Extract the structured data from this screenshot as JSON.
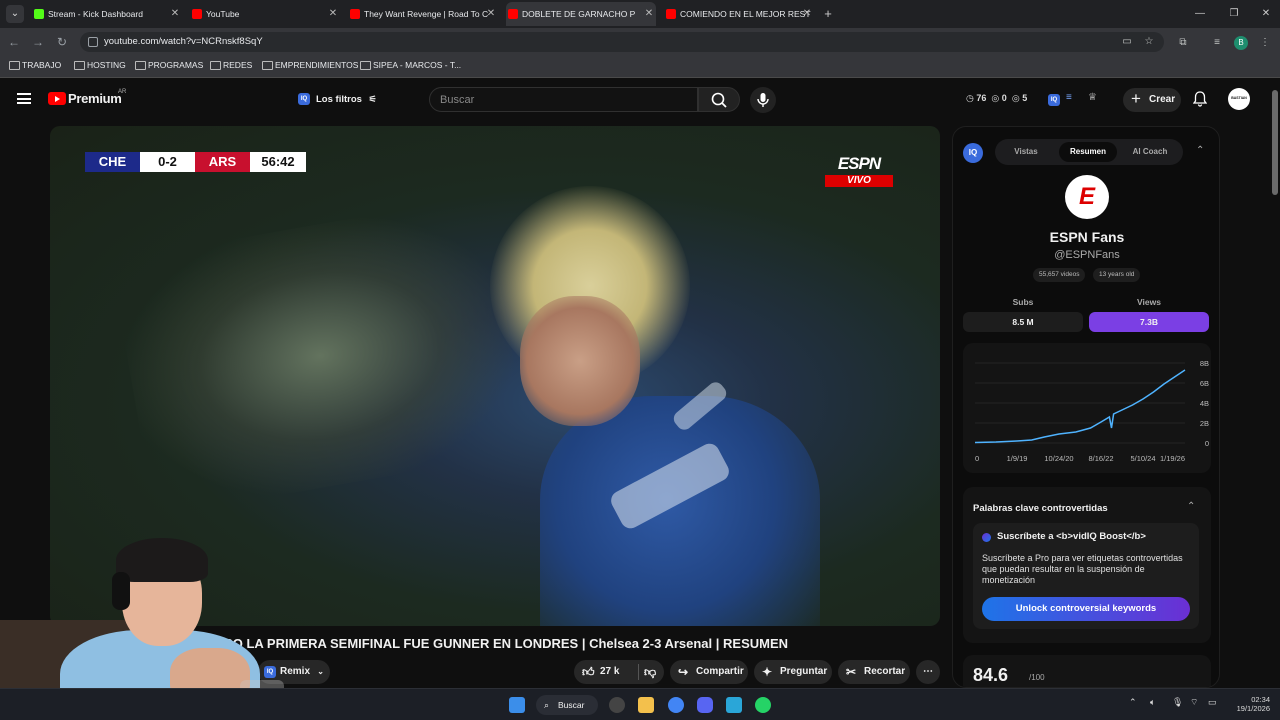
{
  "browser": {
    "tabs": [
      {
        "title": "Stream - Kick Dashboard",
        "color": "#53fc18"
      },
      {
        "title": "YouTube",
        "color": "#ff0000"
      },
      {
        "title": "They Want Revenge | Road To C",
        "color": "#ff0000"
      },
      {
        "title": "DOBLETE DE GARNACHO P",
        "color": "#ff0000"
      },
      {
        "title": "COMIENDO EN EL MEJOR REST",
        "color": "#ff0000"
      }
    ],
    "new_tab": "+",
    "url": "youtube.com/watch?v=NCRnskf8SqY",
    "profile_initial": "B",
    "bookmarks": [
      "TRABAJO",
      "HOSTING",
      "PROGRAMAS",
      "REDES",
      "EMPRENDIMIENTOS",
      "SIPEA - MARCOS - T..."
    ]
  },
  "youtube": {
    "logo_text": "Premium",
    "region": "AR",
    "filters_label": "Los filtros",
    "search_placeholder": "Buscar",
    "stats": {
      "clock": "76",
      "eye": "0",
      "check": "5"
    },
    "create_label": "Crear",
    "avatar_text": "BASTIAN"
  },
  "video": {
    "scoreboard": {
      "home": "CHE",
      "score": "0-2",
      "away": "ARS",
      "time": "56:42"
    },
    "broadcaster": "ESPN",
    "live_badge": "VIVO",
    "title": "PERO LA PRIMERA SEMIFINAL FUE GUNNER EN LONDRES | Chelsea 2-3 Arsenal | RESUMEN",
    "subscribe_partial": "irse",
    "remix_label": "Remix",
    "likes": "27 k",
    "share_label": "Compartir",
    "ask_label": "Preguntar",
    "clip_label": "Recortar"
  },
  "vidiq": {
    "tabs": [
      "Vistas",
      "Resumen",
      "AI Coach"
    ],
    "active_tab": "Resumen",
    "channel_name": "ESPN Fans",
    "channel_handle": "@ESPNFans",
    "videos_chip": "55,657 videos",
    "age_chip": "13 years old",
    "subs_label": "Subs",
    "views_label": "Views",
    "subs_value": "8.5 M",
    "views_value": "7.3B",
    "keywords_title": "Palabras clave controvertidas",
    "boost_title": "Suscríbete a <b>vidIQ Boost</b>",
    "boost_desc": "Suscríbete a Pro para ver etiquetas controvertidas que puedan resultar en la suspensión de monetización",
    "unlock_label": "Unlock controversial keywords",
    "score": "84.6",
    "score_suffix": "/100"
  },
  "chart_data": {
    "type": "line",
    "title": "",
    "x_ticks": [
      "0",
      "1/9/19",
      "10/24/20",
      "8/16/22",
      "5/10/24",
      "1/19/26"
    ],
    "y_ticks": [
      "0",
      "2B",
      "4B",
      "6B",
      "8B"
    ],
    "ylim": [
      0,
      8
    ],
    "series": [
      {
        "x": [
          0,
          0.1,
          0.2,
          0.27,
          0.33,
          0.4,
          0.48,
          0.55,
          0.6,
          0.64,
          0.65,
          0.66,
          0.7,
          0.75,
          0.8,
          0.85,
          0.9,
          0.95,
          1.0
        ],
        "y": [
          0.05,
          0.1,
          0.2,
          0.3,
          0.6,
          0.9,
          1.1,
          1.5,
          2.1,
          2.6,
          1.5,
          2.9,
          3.3,
          3.8,
          4.4,
          5.1,
          5.9,
          6.6,
          7.3
        ]
      }
    ],
    "color": "#4fb3ff"
  },
  "taskbar": {
    "search_label": "Buscar",
    "time": "02:34",
    "date": "19/1/2026"
  }
}
